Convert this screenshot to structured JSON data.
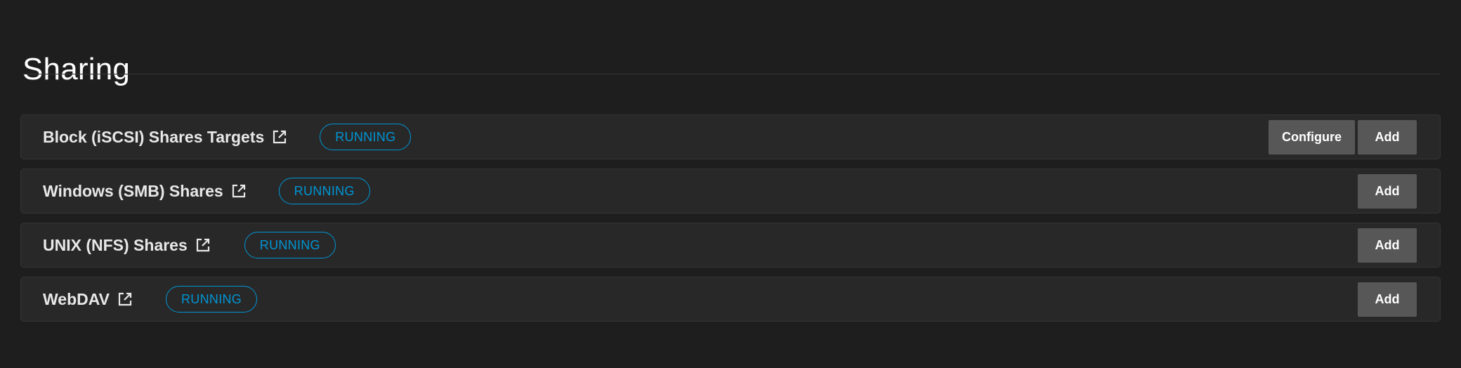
{
  "page": {
    "title": "Sharing"
  },
  "services": [
    {
      "title": "Block (iSCSI) Shares Targets",
      "status": "RUNNING",
      "configure_label": "Configure",
      "add_label": "Add"
    },
    {
      "title": "Windows (SMB) Shares",
      "status": "RUNNING",
      "add_label": "Add"
    },
    {
      "title": "UNIX (NFS) Shares",
      "status": "RUNNING",
      "add_label": "Add"
    },
    {
      "title": "WebDAV",
      "status": "RUNNING",
      "add_label": "Add"
    }
  ],
  "colors": {
    "background": "#1e1e1e",
    "card": "#282828",
    "status_running": "#0095d5",
    "button": "#575757"
  },
  "icons": {
    "external_link": "open-in-new-icon"
  }
}
